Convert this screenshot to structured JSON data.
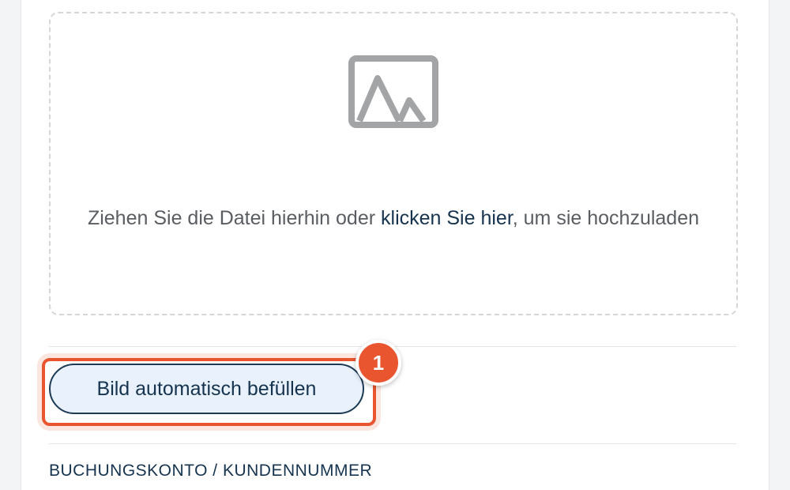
{
  "upload": {
    "icon": "image-placeholder-icon",
    "text_before": "Ziehen Sie die Datei hierhin oder ",
    "link_text": "klicken Sie hier",
    "text_after": ", um sie hochzuladen"
  },
  "autofill": {
    "button_label": "Bild automatisch befüllen",
    "step_number": "1"
  },
  "next_section": {
    "label": "BUCHUNGSKONTO / KUNDENNUMMER"
  },
  "colors": {
    "accent": "#16344f",
    "highlight": "#e9552f",
    "button_bg": "#e9f2fc"
  }
}
